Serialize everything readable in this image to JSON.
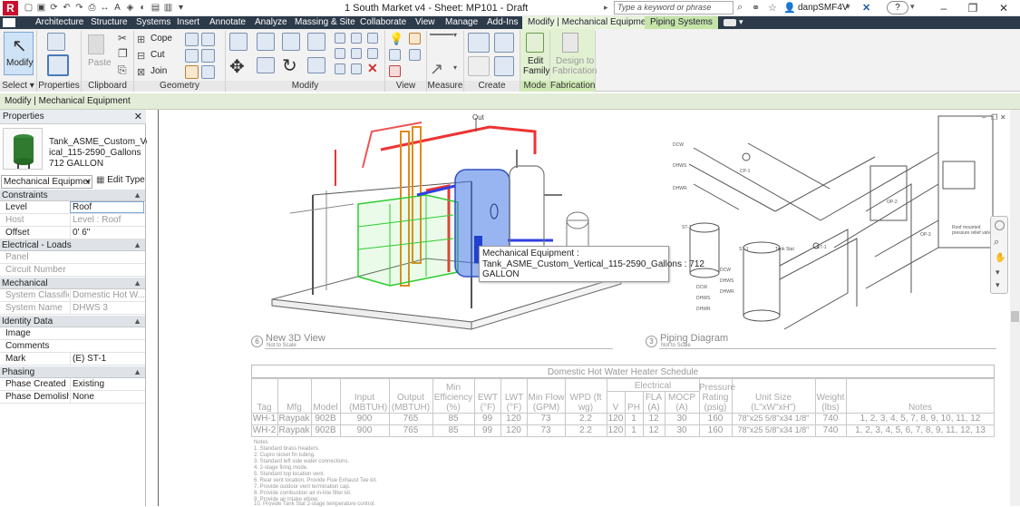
{
  "app": {
    "logo": "R",
    "doc_title": "1 South Market v4 - Sheet: MP101 - Draft",
    "search_placeholder": "Type a keyword or phrase",
    "user": "danpSMF4V",
    "help": "?"
  },
  "tabs": [
    "Architecture",
    "Structure",
    "Systems",
    "Insert",
    "Annotate",
    "Analyze",
    "Massing & Site",
    "Collaborate",
    "View",
    "Manage",
    "Add-Ins"
  ],
  "context_tabs": [
    "Modify | Mechanical Equipment",
    "Piping Systems"
  ],
  "ribbon": {
    "modify_label": "Modify",
    "paste_label": "Paste",
    "cope": "Cope",
    "cut": "Cut",
    "join": "Join",
    "edit_family_1": "Edit",
    "edit_family_2": "Family",
    "design_fab_1": "Design to",
    "design_fab_2": "Fabrication",
    "panels": [
      "Select",
      "Properties",
      "Clipboard",
      "Geometry",
      "Modify",
      "View",
      "Measure",
      "Create",
      "Mode",
      "Fabrication"
    ]
  },
  "context_bar": "Modify | Mechanical Equipment",
  "properties": {
    "title": "Properties",
    "type_line1": "Tank_ASME_Custom_Vert",
    "type_line2": "ical_115-2590_Gallons",
    "type_line3": "712 GALLON",
    "category": "Mechanical Equipmer",
    "edit_type": "Edit Type",
    "sections": [
      {
        "name": "Constraints",
        "rows": [
          {
            "k": "Level",
            "v": "Roof"
          },
          {
            "k": "Host",
            "v": "Level : Roof"
          },
          {
            "k": "Offset",
            "v": "0'  6\""
          }
        ]
      },
      {
        "name": "Electrical - Loads",
        "rows": [
          {
            "k": "Panel",
            "v": ""
          },
          {
            "k": "Circuit Number",
            "v": ""
          }
        ]
      },
      {
        "name": "Mechanical",
        "rows": [
          {
            "k": "System Classific...",
            "v": "Domestic Hot W..."
          },
          {
            "k": "System Name",
            "v": "DHWS 3"
          }
        ]
      },
      {
        "name": "Identity Data",
        "rows": [
          {
            "k": "Image",
            "v": ""
          },
          {
            "k": "Comments",
            "v": ""
          },
          {
            "k": "Mark",
            "v": "(E) ST-1"
          }
        ]
      },
      {
        "name": "Phasing",
        "rows": [
          {
            "k": "Phase Created",
            "v": "Existing"
          },
          {
            "k": "Phase Demolish...",
            "v": "None"
          }
        ]
      }
    ]
  },
  "drawing": {
    "out_label": "Out",
    "tooltip": [
      "Mechanical Equipment :",
      "Tank_ASME_Custom_Vertical_115-2590_Gallons : 712",
      "GALLON"
    ],
    "view1_num": "6",
    "view1_title": "New 3D View",
    "view1_scale": "Not to Scale",
    "view2_num": "3",
    "view2_title": "Piping Diagram",
    "view2_scale": "Not to Scale",
    "piping_labels": [
      "DCW",
      "DHWS",
      "DHWR",
      "CP-1",
      "ST-1",
      "Tank Stat",
      "ET-1",
      "DCW",
      "DHWS",
      "DHWR",
      "ST-1",
      "DCW",
      "DHWS",
      "DHWR",
      "OP-2",
      "OP-3",
      "Roof mounted pressure relief valve"
    ]
  },
  "schedule": {
    "title": "Domestic Hot Water Heater Schedule",
    "electrical_header": "Electrical",
    "headers": [
      "Tag",
      "Mfg",
      "Model",
      "Input (MBTUH)",
      "Output (MBTUH)",
      "Min Efficiency (%)",
      "EWT (°F)",
      "LWT (°F)",
      "Min Flow (GPM)",
      "WPD (ft wg)",
      "V",
      "PH",
      "FLA (A)",
      "MOCP (A)",
      "Pressure Rating (psig)",
      "Unit Size (L\"xW\"xH\")",
      "Weight (lbs)",
      "Notes"
    ],
    "rows": [
      [
        "WH-1",
        "Raypak",
        "902B",
        "900",
        "765",
        "85",
        "99",
        "120",
        "73",
        "2.2",
        "120",
        "1",
        "12",
        "30",
        "160",
        "78\"x25 5/8\"x34 1/8\"",
        "740",
        "1, 2, 3, 4, 5, 7, 8, 9, 10, 11, 12"
      ],
      [
        "WH-2",
        "Raypak",
        "902B",
        "900",
        "765",
        "85",
        "99",
        "120",
        "73",
        "2.2",
        "120",
        "1",
        "12",
        "30",
        "160",
        "78\"x25 5/8\"x34 1/8\"",
        "740",
        "1, 2, 3, 4, 5, 6, 7, 8, 9, 11, 12, 13"
      ]
    ],
    "notes": [
      "Notes",
      "1.  Standard brass headers.",
      "2.  Cupro nickel fin tubing.",
      "3.  Standard left side water connections.",
      "4.  2-stage firing mode.",
      "5.  Standard top location vent.",
      "6.  Rear vent location.  Provide Flue Exhaust Tee kit.",
      "7.  Provide outdoor vent termination cap.",
      "8.  Provide combustion air in-line filter kit.",
      "9.  Provide air intake elbow.",
      "10.  Provide Tank Stat 2-stage temperature control."
    ]
  }
}
